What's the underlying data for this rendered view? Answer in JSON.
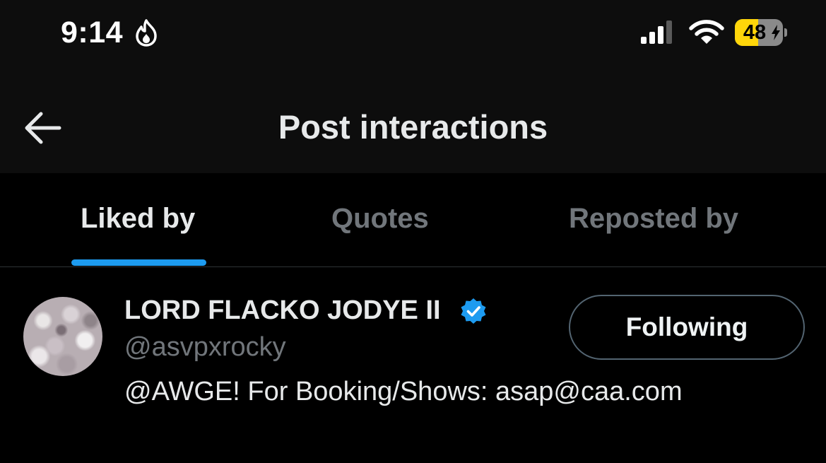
{
  "status_bar": {
    "time": "9:14",
    "focus_icon": "flame-icon",
    "signal_icon": "cellular-signal-icon",
    "wifi_icon": "wifi-icon",
    "battery_percent": "48",
    "battery_level": 0.48,
    "battery_charging": true,
    "battery_color": "#ffd60a"
  },
  "header": {
    "back_icon": "back-arrow-icon",
    "title": "Post interactions"
  },
  "tabs": [
    {
      "label": "Liked by",
      "active": true
    },
    {
      "label": "Quotes",
      "active": false
    },
    {
      "label": "Reposted by",
      "active": false
    }
  ],
  "colors": {
    "accent": "#1d9bf0",
    "background": "#000000",
    "secondary_text": "#71767b"
  },
  "users": [
    {
      "display_name": "LORD FLACKO JODYE II",
      "verified": true,
      "verified_icon": "verified-badge-icon",
      "handle": "@asvpxrocky",
      "bio": "@AWGE! For Booking/Shows: asap@caa.com",
      "follow_button_label": "Following"
    }
  ]
}
